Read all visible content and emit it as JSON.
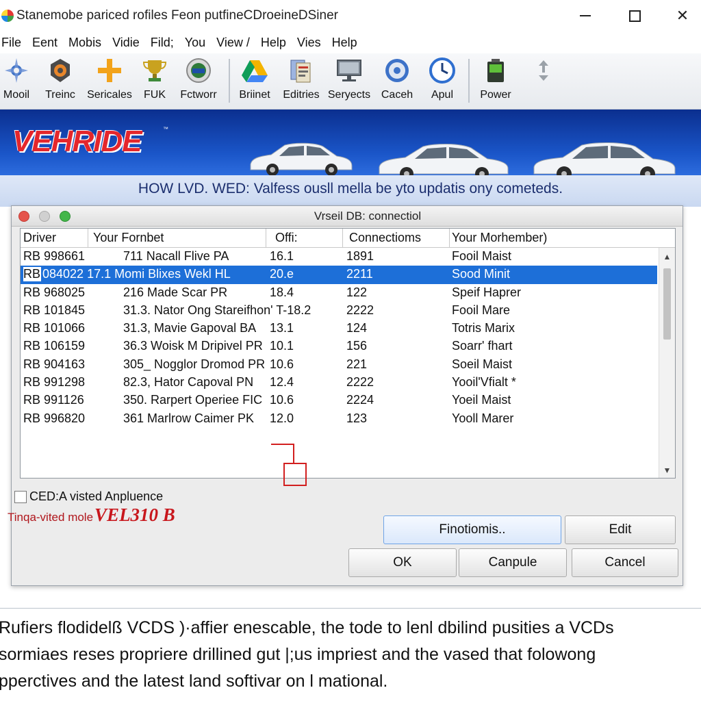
{
  "window": {
    "title": "Stanemobe pariced rofiles Feon putfineCDroeineDSiner",
    "close_glyph": "✕"
  },
  "menu": [
    "File",
    "Eent",
    "Mobis",
    "Vidie",
    "Fild;",
    "You",
    "View /",
    "Help",
    "Vies",
    "Help"
  ],
  "toolbar": {
    "items": [
      {
        "label": "Mooil",
        "icon": "satellite-icon"
      },
      {
        "label": "Treinc",
        "icon": "gear-shield-icon"
      },
      {
        "label": "Sericales",
        "icon": "plus-icon"
      },
      {
        "label": "FUK",
        "icon": "trophy-icon"
      },
      {
        "label": "Fctworr",
        "icon": "globe-badge-icon"
      },
      {
        "label": "Briinet",
        "icon": "drive-icon"
      },
      {
        "label": "Editries",
        "icon": "documents-icon"
      },
      {
        "label": "Seryects",
        "icon": "monitor-icon"
      },
      {
        "label": "Caceh",
        "icon": "disc-icon"
      },
      {
        "label": "Apul",
        "icon": "clock-icon"
      },
      {
        "label": "Power",
        "icon": "battery-icon"
      }
    ],
    "extra_icon": "arrows-icon"
  },
  "banner": {
    "brand": "VEHRIDE",
    "trademark": "™",
    "text": "HOW LVD. WED: Valfess ousll mella be yto updatis ony cometeds.",
    "colors": {
      "brand": "#e4262c",
      "background": "#1a55c8"
    }
  },
  "dialog": {
    "title": "Vrseil DB: connectiol",
    "columns": [
      "Driver",
      "Your Fornbet",
      "Offi:",
      "Connectioms",
      "Your Morhember)"
    ],
    "rows": [
      {
        "driver": "RB 998661",
        "format": "711  Nacall Flive PA",
        "offi": "16.1",
        "connections": "1891",
        "member": "Fooil Maist",
        "selected": false
      },
      {
        "driver": "RB",
        "format": "084022 17.1  Momi Blixes Wekl HL",
        "offi": "20.e",
        "connections": "2211",
        "member": "Sood Minit",
        "selected": true
      },
      {
        "driver": "RB 968025",
        "format": "216  Made Scar PR",
        "offi": "18.4",
        "connections": "122",
        "member": "Speif Haprer",
        "selected": false
      },
      {
        "driver": "RB 101845",
        "format": "31.3. Nator Ong Stareifhon' T-18.2",
        "offi": "",
        "connections": "2222",
        "member": "Fooil Mare",
        "selected": false
      },
      {
        "driver": "RB 101066",
        "format": "31.3, Mavie Gapoval BA",
        "offi": "13.1",
        "connections": "124",
        "member": "Totris Marix",
        "selected": false
      },
      {
        "driver": "RB 106159",
        "format": "36.3  Woisk M Dripivel PR",
        "offi": "10.1",
        "connections": "156",
        "member": "Soarr' fhart",
        "selected": false
      },
      {
        "driver": "RB 904163",
        "format": "305_  Nogglor Dromod PR",
        "offi": "10.6",
        "connections": "221",
        "member": "Soeil Maist",
        "selected": false
      },
      {
        "driver": "RB 991298",
        "format": "82.3, Hator Capoval PN",
        "offi": "12.4",
        "connections": "2222",
        "member": "Yooil'Vfialt *",
        "selected": false
      },
      {
        "driver": "RB 991126",
        "format": "350.  Rarpert Operiee FIC",
        "offi": "10.6",
        "connections": "2224",
        "member": "Yoeil Maist",
        "selected": false
      },
      {
        "driver": "RB 996820",
        "format": "361  Marlrow Caimer PK",
        "offi": "12.0",
        "connections": "123",
        "member": "Yooll Marer",
        "selected": false
      }
    ],
    "checkbox_label": "CED:A visted Anpluence",
    "checkbox_checked": false,
    "version_label": "Tinqa-vited mole",
    "version_value": "VEL310 B",
    "buttons": {
      "functions": "Finotiomis..",
      "edit": "Edit",
      "ok": "OK",
      "capule": "Canpule",
      "cancel": "Cancel"
    }
  },
  "caption": [
    "Rufiers flodidelß VCDS )·affier enescable, the tode to lenl dbilind pusities a VCDs",
    "sormiaes reses propriere drillined gut |;us impriest and the vased that folowong",
    "pperctives and the latest land softivar on l mational."
  ]
}
